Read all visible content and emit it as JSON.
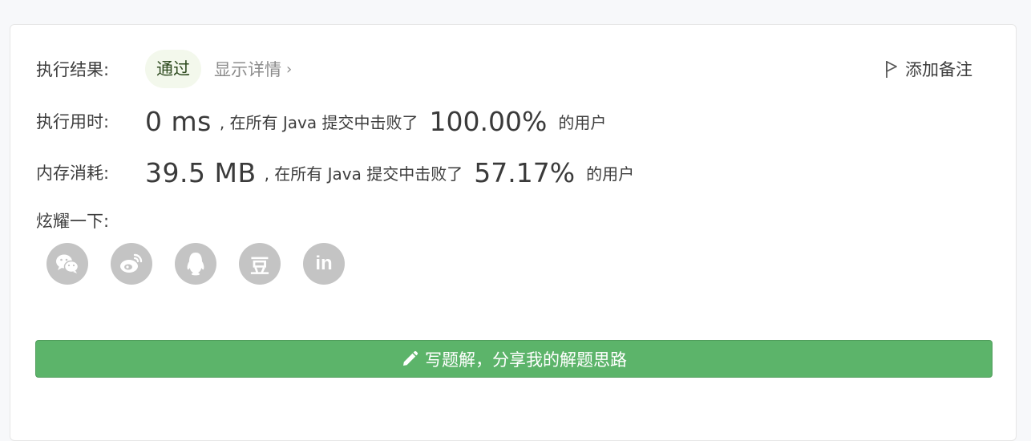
{
  "result": {
    "label": "执行结果:",
    "status": "通过",
    "details_link": "显示详情",
    "chevron": "›"
  },
  "add_note": {
    "label": "添加备注",
    "icon": "flag-icon"
  },
  "runtime": {
    "label": "执行用时:",
    "value": "0 ms",
    "middle": ", 在所有 Java 提交中击败了",
    "percent": "100.00%",
    "suffix": "的用户"
  },
  "memory": {
    "label": "内存消耗:",
    "value": "39.5 MB",
    "middle": ", 在所有 Java 提交中击败了",
    "percent": "57.17%",
    "suffix": "的用户"
  },
  "share": {
    "label": "炫耀一下:",
    "icons": [
      "wechat-icon",
      "weibo-icon",
      "qq-icon",
      "douban-icon",
      "linkedin-icon"
    ],
    "douban_glyph": "豆",
    "linkedin_glyph": "in"
  },
  "solution_button": {
    "label": "写题解，分享我的解题思路",
    "icon": "pencil-icon"
  },
  "colors": {
    "accent_green": "#5cb46a",
    "badge_bg": "#f3f8ec",
    "icon_gray": "#c4c4c4"
  }
}
